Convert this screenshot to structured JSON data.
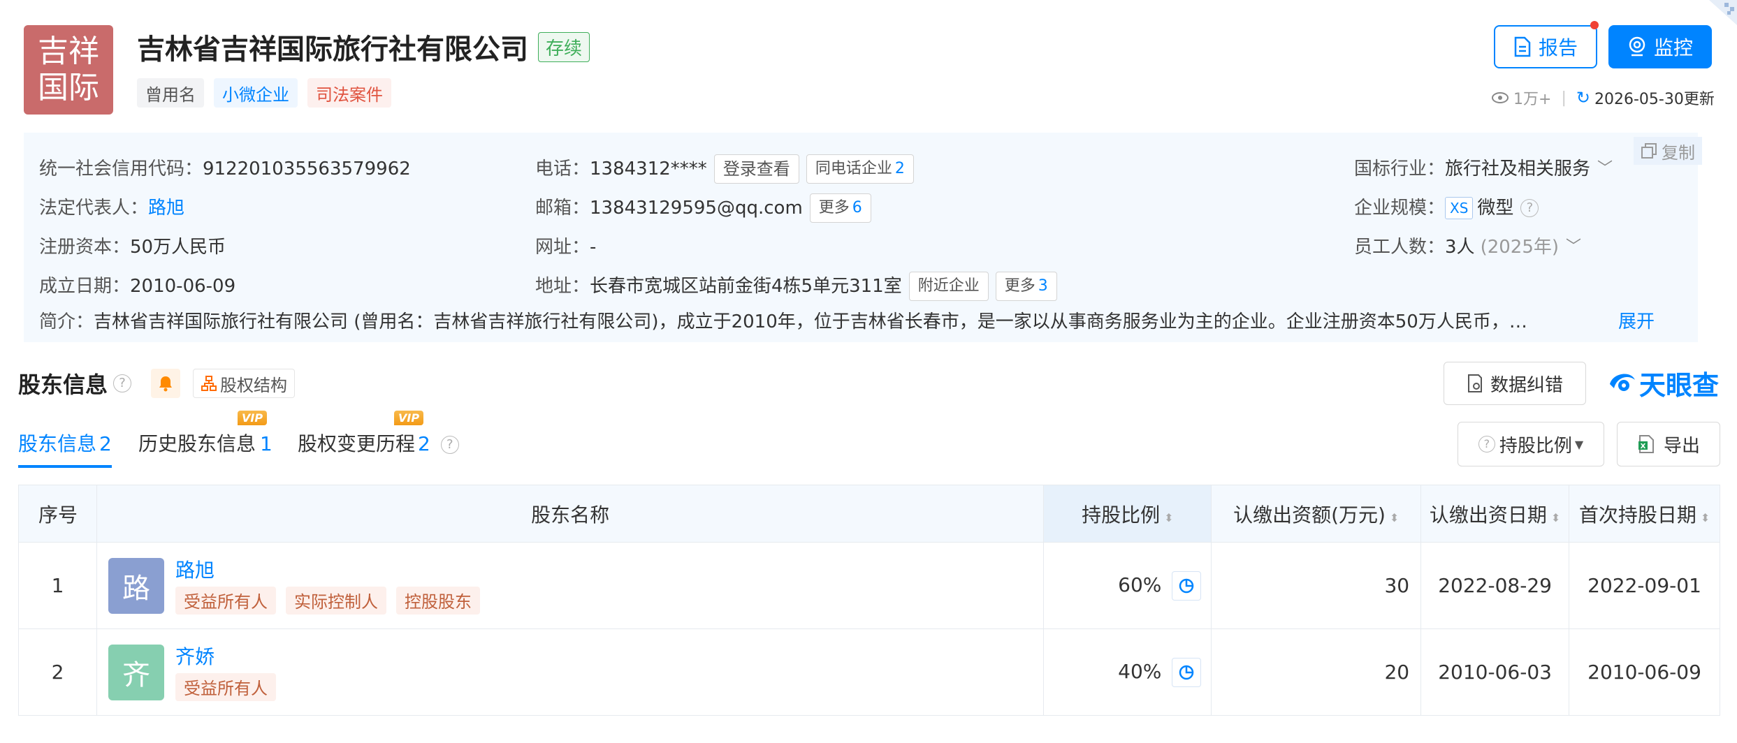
{
  "company": {
    "logo_text_line1": "吉祥",
    "logo_text_line2": "国际",
    "name": "吉林省吉祥国际旅行社有限公司",
    "status": "存续",
    "tags": [
      "曾用名",
      "小微企业",
      "司法案件"
    ]
  },
  "header_actions": {
    "report_label": "报告",
    "monitor_label": "监控",
    "views": "1万+",
    "updated": "2026-05-30更新"
  },
  "info": {
    "credit_code_label": "统一社会信用代码：",
    "credit_code": "912201035563579962",
    "legal_rep_label": "法定代表人：",
    "legal_rep": "路旭",
    "capital_label": "注册资本：",
    "capital": "50万人民币",
    "founded_label": "成立日期：",
    "founded": "2010-06-09",
    "phone_label": "电话：",
    "phone": "1384312****",
    "login_view": "登录查看",
    "same_phone": "同电话企业",
    "same_phone_count": "2",
    "email_label": "邮箱：",
    "email": "13843129595@qq.com",
    "more_label": "更多",
    "email_more_count": "6",
    "website_label": "网址：",
    "website": "-",
    "address_label": "地址：",
    "address": "长春市宽城区站前金街4栋5单元311室",
    "nearby": "附近企业",
    "address_more_count": "3",
    "industry_label": "国标行业：",
    "industry": "旅行社及相关服务",
    "scale_label": "企业规模：",
    "scale_badge": "XS",
    "scale": "微型",
    "staff_label": "员工人数：",
    "staff": "3人",
    "staff_year": "(2025年)",
    "copy_label": "复制",
    "intro_label": "简介：",
    "intro": "吉林省吉祥国际旅行社有限公司 (曾用名：吉林省吉祥旅行社有限公司)，成立于2010年，位于吉林省长春市，是一家以从事商务服务业为主的企业。企业注册资本50万人民币，…",
    "expand": "展开"
  },
  "shareholder_section": {
    "title": "股东信息",
    "structure_btn": "股权结构",
    "data_fix_btn": "数据纠错",
    "brand": "天眼查",
    "tabs": [
      {
        "label": "股东信息",
        "count": "2"
      },
      {
        "label": "历史股东信息",
        "count": "1",
        "badge": "VIP"
      },
      {
        "label": "股权变更历程",
        "count": "2",
        "badge": "VIP"
      }
    ],
    "ratio_filter": "持股比例",
    "export_label": "导出",
    "columns": [
      "序号",
      "股东名称",
      "持股比例",
      "认缴出资额(万元)",
      "认缴出资日期",
      "首次持股日期"
    ],
    "rows": [
      {
        "index": "1",
        "avatar": "路",
        "avatar_color": "#8a9fd1",
        "name": "路旭",
        "tags": [
          "受益所有人",
          "实际控制人",
          "控股股东"
        ],
        "ratio": "60%",
        "amount": "30",
        "sub_date": "2022-08-29",
        "first_date": "2022-09-01"
      },
      {
        "index": "2",
        "avatar": "齐",
        "avatar_color": "#86cfb0",
        "name": "齐娇",
        "tags": [
          "受益所有人"
        ],
        "ratio": "40%",
        "amount": "20",
        "sub_date": "2010-06-03",
        "first_date": "2010-06-09"
      }
    ]
  },
  "colors": {
    "accent": "#0084ff",
    "logo_bg": "#c96b6b",
    "status_green": "#3fae5a",
    "info_bg": "#f4f9fe",
    "tag_red": "#e0533f"
  }
}
